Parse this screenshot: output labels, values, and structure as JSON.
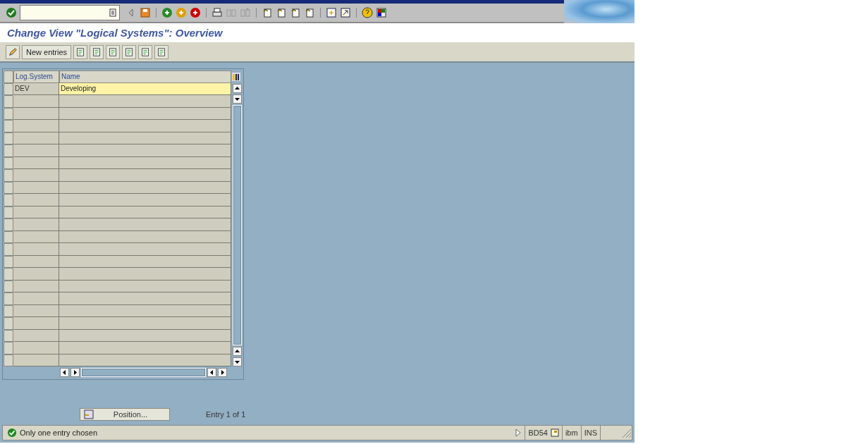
{
  "title": "Change View \"Logical Systems\": Overview",
  "app_toolbar": {
    "new_entries": "New entries"
  },
  "table": {
    "columns": [
      "Log.System",
      "Name"
    ],
    "rows": [
      {
        "log_system": "DEV",
        "name": "Developing",
        "highlighted": true
      }
    ]
  },
  "position_button": "Position...",
  "entry_count": "Entry 1 of 1",
  "status_bar": {
    "message": {
      "kind": "success",
      "text": "Only one entry chosen"
    },
    "transaction": "BD54",
    "system": "ibm",
    "mode": "INS"
  }
}
